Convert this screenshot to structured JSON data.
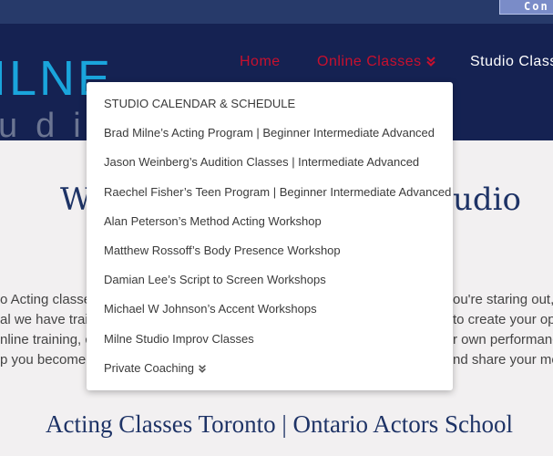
{
  "topbar": {
    "contact_label": "Con"
  },
  "logo": {
    "main": "ILNE",
    "sub": "udi"
  },
  "nav": {
    "home": "Home",
    "online_classes": "Online Classes",
    "studio": "Studio Class"
  },
  "content": {
    "heading_left": "W",
    "heading_right": "udio",
    "para_lines_left": [
      "o Acting classes",
      "al we have trai",
      "nline training, c",
      "p you become"
    ],
    "para_lines_right": [
      "ou're staring out, c",
      "to create your op",
      "r own performanc",
      "nd share your mo"
    ],
    "subheading": "Acting Classes Toronto | Ontario Actors School"
  },
  "dropdown": {
    "items": [
      "STUDIO CALENDAR & SCHEDULE",
      "Brad Milne’s Acting Program | Beginner Intermediate Advanced",
      "Jason Weinberg’s Audition Classes | Intermediate Advanced",
      "Raechel Fisher’s Teen Program | Beginner Intermediate Advanced",
      "Alan Peterson’s Method Acting Workshop",
      "Matthew Rossoff’s Body Presence Workshop",
      "Damian Lee’s Script to Screen Workshops",
      "Michael W Johnson’s Accent Workshops",
      "Milne Studio Improv Classes"
    ],
    "private_coaching": "Private Coaching"
  },
  "colors": {
    "header_bg": "#152252",
    "topbar_bg": "#273a6a",
    "accent_red": "#c8102e",
    "logo_blue": "#1aa5dc",
    "heading_navy": "#1e3366"
  }
}
